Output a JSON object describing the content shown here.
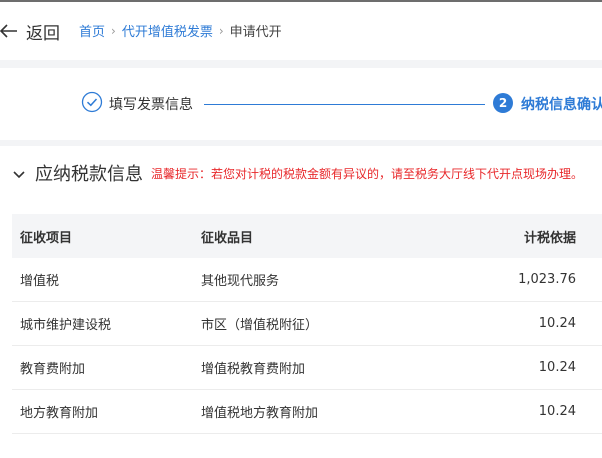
{
  "header": {
    "back_label": "返回",
    "breadcrumb": [
      {
        "label": "首页"
      },
      {
        "label": "代开增值税发票"
      }
    ],
    "separator": "›",
    "current": "申请代开"
  },
  "steps": {
    "step1_label": "填写发票信息",
    "step2_number": "2",
    "step2_label": "纳税信息确认"
  },
  "section": {
    "title": "应纳税款信息",
    "warning": "温馨提示：若您对计税的税款金额有异议的，请至税务大厅线下代开点现场办理。"
  },
  "table": {
    "headers": [
      "征收项目",
      "征收品目",
      "计税依据"
    ],
    "rows": [
      [
        "增值税",
        "其他现代服务",
        "1,023.76"
      ],
      [
        "城市维护建设税",
        "市区（增值税附征）",
        "10.24"
      ],
      [
        "教育费附加",
        "增值税教育费附加",
        "10.24"
      ],
      [
        "地方教育附加",
        "增值税地方教育附加",
        "10.24"
      ]
    ]
  },
  "colors": {
    "accent": "#2e7bd6",
    "warning": "#e8282b"
  },
  "icons": {
    "back": "arrow-left-icon",
    "step_done": "check-circle-icon",
    "collapse": "chevron-down-icon"
  }
}
